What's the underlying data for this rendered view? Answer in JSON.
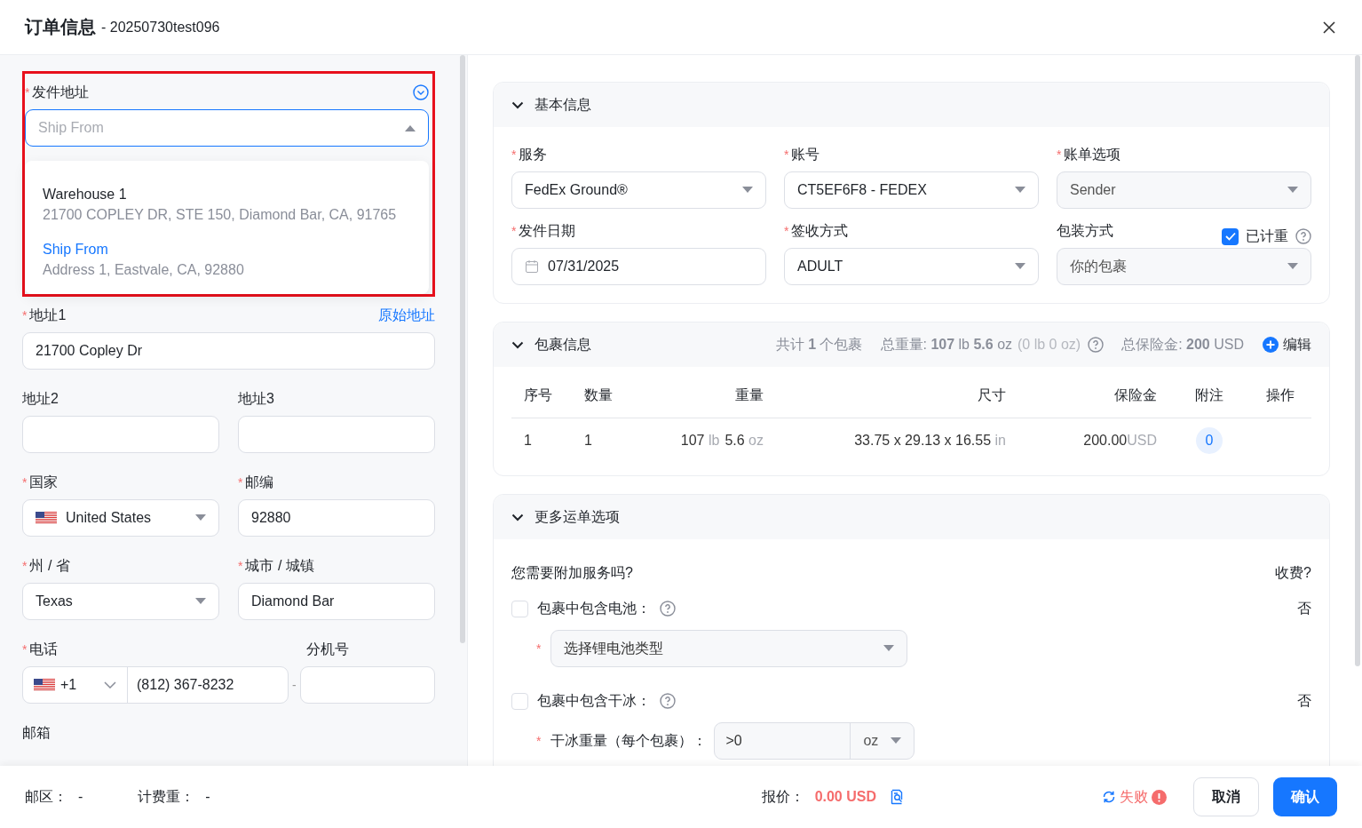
{
  "dialog": {
    "title": "订单信息",
    "subtitle": "- 20250730test096"
  },
  "ship_from": {
    "label": "发件地址",
    "mark": "*",
    "placeholder": "Ship From",
    "open": true,
    "options": [
      {
        "name": "Warehouse 1",
        "address": "21700 COPLEY DR, STE 150, Diamond Bar, CA, 91765",
        "selected": false
      },
      {
        "name": "Ship From",
        "address": "Address 1, Eastvale, CA, 92880",
        "selected": true
      }
    ]
  },
  "address1": {
    "label": "地址1",
    "mark": "*",
    "link": "原始地址",
    "value": "21700 Copley Dr"
  },
  "address_rows": [
    [
      {
        "label": "地址2",
        "kind": "text"
      },
      {
        "label": "地址3",
        "kind": "text"
      }
    ],
    [
      {
        "label": "国家",
        "mark": "*",
        "kind": "country",
        "value": "United States"
      },
      {
        "label": "邮编",
        "mark": "*",
        "kind": "text",
        "value": "92880"
      }
    ],
    [
      {
        "label": "州 / 省",
        "mark": "*",
        "kind": "select",
        "value": "Texas"
      },
      {
        "label": "城市 / 城镇",
        "mark": "*",
        "kind": "text",
        "value": "Diamond Bar"
      }
    ]
  ],
  "phone": {
    "label": "电话",
    "mark": "*",
    "code": "+1",
    "value": "(812) 367-8232",
    "separator": "-",
    "extension_label": "分机号"
  },
  "email": {
    "label": "邮箱"
  },
  "basic": {
    "title": "基本信息",
    "expanded": true,
    "fields": [
      {
        "label": "服务",
        "mark": "*",
        "kind": "select",
        "value": "FedEx Ground®",
        "disabled": false
      },
      {
        "label": "账号",
        "mark": "*",
        "kind": "select",
        "value": "CT5EF6F8 - FEDEX",
        "disabled": false
      },
      {
        "label": "账单选项",
        "mark": "*",
        "kind": "select",
        "value": "Sender",
        "disabled": true
      },
      {
        "label": "发件日期",
        "mark": "*",
        "kind": "date",
        "value": "07/31/2025",
        "disabled": false
      },
      {
        "label": "签收方式",
        "mark": "*",
        "kind": "select",
        "value": "ADULT",
        "disabled": false
      },
      {
        "label": "包装方式",
        "kind": "select",
        "value": "你的包裹",
        "disabled": true
      }
    ],
    "weighed": {
      "label": "已计重",
      "checked": true
    }
  },
  "packages": {
    "title": "包裹信息",
    "expanded": true,
    "summary": [
      "共计 **1** 个包裹",
      "总重量: **107** lb **5.6** oz"
    ],
    "summary_extra": "(0 lb 0 oz)",
    "insurance": "总保险金: **200** USD",
    "edit": "编辑",
    "columns": [
      "序号",
      "数量",
      "重量",
      "尺寸",
      "保险金",
      "附注",
      "操作"
    ],
    "rows": [
      {
        "index": "1",
        "qty": "1",
        "lb": "107",
        "lb_unit": "lb",
        "oz": "5.6",
        "oz_unit": "oz",
        "dims": "33.75 x 29.13 x 16.55",
        "dims_unit": "in",
        "insurance": "200.00",
        "currency": "USD",
        "notes": "0"
      }
    ]
  },
  "more": {
    "title": "更多运单选项",
    "expanded": true,
    "question": "您需要附加服务吗?",
    "fee_header": "收费?",
    "options": [
      {
        "label": "包裹中包含电池：",
        "checked": false,
        "fee": "否",
        "sub": {
          "kind": "select",
          "mark": "*",
          "placeholder": "选择锂电池类型"
        }
      },
      {
        "label": "包裹中包含干冰：",
        "checked": false,
        "fee": "否",
        "sub": {
          "kind": "weight",
          "mark": "*",
          "label": "干冰重量（每个包裹）：",
          "placeholder": ">0",
          "unit": "oz"
        }
      }
    ]
  },
  "footer": {
    "zone_label": "邮区：",
    "zone": "-",
    "billable_label": "计费重：",
    "billable": "-",
    "quote_label": "报价：",
    "quote": "0.00 USD",
    "status": "失败",
    "buttons": [
      {
        "label": "取消",
        "primary": false
      },
      {
        "label": "确认",
        "primary": true
      }
    ]
  }
}
